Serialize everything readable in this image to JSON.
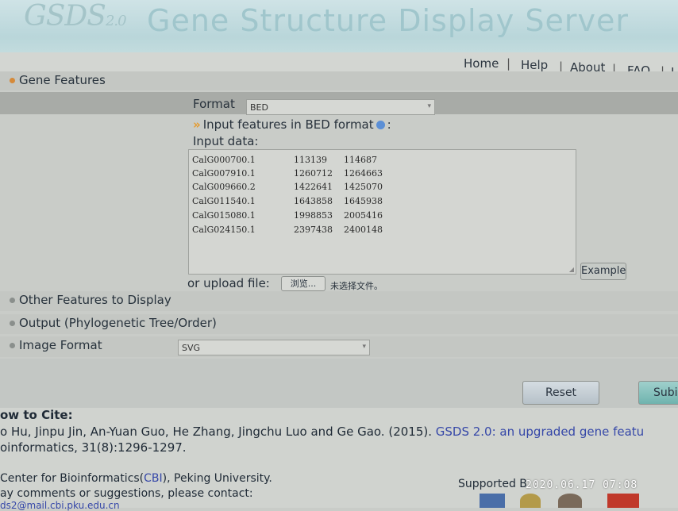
{
  "header": {
    "logo_text": "GSDS",
    "logo_version": "2.0",
    "title": "Gene Structure Display Server"
  },
  "nav": {
    "items": [
      "Home",
      "Help",
      "About",
      "FAQ",
      "L"
    ],
    "separator": "|"
  },
  "sections": {
    "gene_features": "Gene Features",
    "other_features": "Other Features to Display",
    "output": "Output (Phylogenetic Tree/Order)",
    "image_format": "Image Format"
  },
  "form": {
    "format_label": "Format",
    "format_value": "BED",
    "hint_prefix": "Input features in BED format",
    "hint_suffix": ":",
    "input_label": "Input data:",
    "rows": [
      [
        "CalG000700.1",
        "113139",
        "114687"
      ],
      [
        "CalG007910.1",
        "1260712",
        "1264663"
      ],
      [
        "CalG009660.2",
        "1422641",
        "1425070"
      ],
      [
        "CalG011540.1",
        "1643858",
        "1645938"
      ],
      [
        "CalG015080.1",
        "1998853",
        "2005416"
      ],
      [
        "CalG024150.1",
        "2397438",
        "2400148"
      ]
    ],
    "example_label": "Example",
    "upload_label": "or upload file:",
    "browse_label": "浏览...",
    "no_file_label": "未选择文件。",
    "image_format_value": "SVG"
  },
  "buttons": {
    "reset": "Reset",
    "submit": "Subi"
  },
  "citation": {
    "heading": "ow to Cite:",
    "authors": "o Hu, Jinpu Jin, An-Yuan Guo, He Zhang, Jingchu Luo and Ge Gao. (2015).",
    "link_text": "GSDS 2.0: an upgraded gene featu",
    "journal": "oinformatics, 31(8):1296-1297."
  },
  "footer": {
    "center_prefix": "Center for Bioinformatics(",
    "center_link": "CBI",
    "center_suffix": "), Peking University.",
    "contact": "ay comments or suggestions, please contact:",
    "email": "ds2@mail.cbi.pku.edu.cn",
    "supported": "Supported B"
  },
  "overlay": {
    "timestamp": "2020.06.17 07:08"
  },
  "colors": {
    "banner": "#b9d6da",
    "section_bar": "#c4c7c3",
    "format_bar": "#a8aba7",
    "link": "#3547a8",
    "hint_icon": "#e59a2c",
    "info_icon": "#5b8fd6"
  }
}
